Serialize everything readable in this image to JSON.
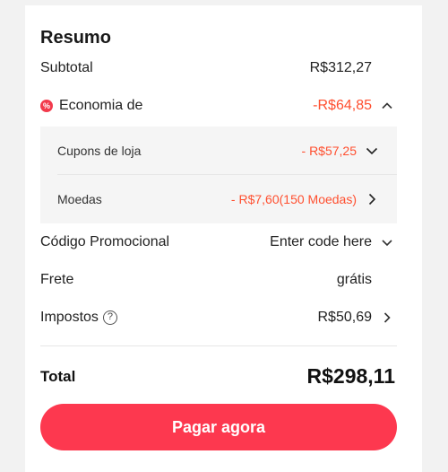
{
  "summary": {
    "title": "Resumo",
    "subtotal": {
      "label": "Subtotal",
      "value": "R$312,27"
    },
    "savings": {
      "badge": "%",
      "label": "Economia de",
      "value": "-R$64,85",
      "expanded": true,
      "items": [
        {
          "label": "Cupons de loja",
          "value": "- R$57,25",
          "icon": "chevron-down-icon"
        },
        {
          "label": "Moedas",
          "value": "- R$7,60(150 Moedas)",
          "icon": "chevron-right-icon"
        }
      ]
    },
    "promo_code": {
      "label": "Código Promocional",
      "placeholder": "Enter code here"
    },
    "shipping": {
      "label": "Frete",
      "value": "grátis"
    },
    "taxes": {
      "label": "Impostos",
      "help": "?",
      "value": "R$50,69"
    },
    "total": {
      "label": "Total",
      "value": "R$298,11"
    },
    "pay_button": {
      "label": "Pagar agora"
    }
  },
  "colors": {
    "accent_red": "#ff4f2f",
    "button_red": "#fd384f",
    "sub_box_bg": "#f5f5f5"
  }
}
